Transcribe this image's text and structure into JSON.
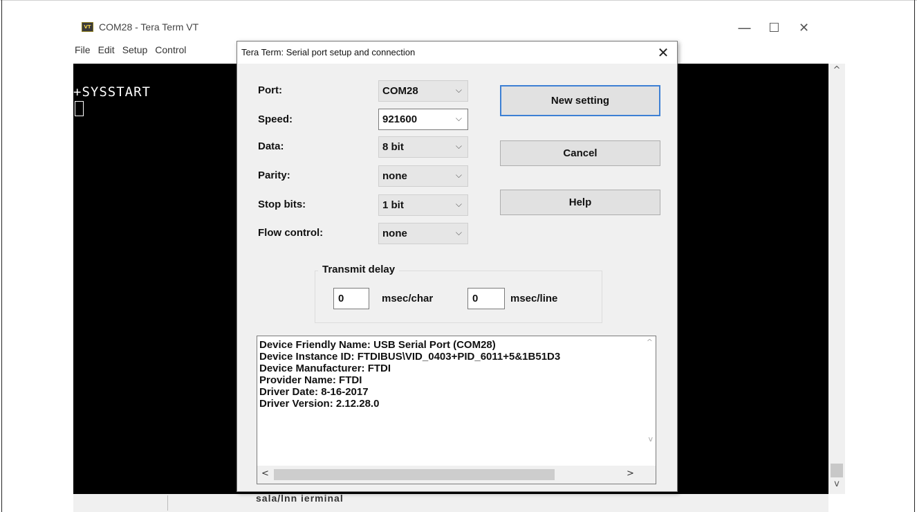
{
  "window": {
    "app_icon_text": "VT",
    "title": "COM28 - Tera Term VT",
    "minimize": "—",
    "maximize": "☐",
    "close": "✕"
  },
  "menu": [
    "File",
    "Edit",
    "Setup",
    "Control"
  ],
  "terminal": {
    "output_line": "+SYSSTART",
    "scroll_up": "^",
    "scroll_down": "v"
  },
  "status_bar": {
    "text": "sala/lnn  ierminal"
  },
  "dialog": {
    "title": "Tera Term: Serial port setup and connection",
    "close": "✕",
    "fields": [
      {
        "label": "Port:",
        "value": "COM28"
      },
      {
        "label": "Speed:",
        "value": "921600"
      },
      {
        "label": "Data:",
        "value": "8 bit"
      },
      {
        "label": "Parity:",
        "value": "none"
      },
      {
        "label": "Stop bits:",
        "value": "1 bit"
      },
      {
        "label": "Flow control:",
        "value": "none"
      }
    ],
    "buttons": {
      "new_setting": "New setting",
      "cancel": "Cancel",
      "help": "Help"
    },
    "transmit_delay": {
      "legend": "Transmit delay",
      "char_value": "0",
      "char_unit": "msec/char",
      "line_value": "0",
      "line_unit": "msec/line"
    },
    "device_info": [
      "Device Friendly Name: USB Serial Port (COM28)",
      "Device Instance ID: FTDIBUS\\VID_0403+PID_6011+5&1B51D3",
      "Device Manufacturer: FTDI",
      "Provider Name: FTDI",
      "Driver Date: 8-16-2017",
      "Driver Version: 2.12.28.0"
    ],
    "scroll": {
      "up": "^",
      "down": "v",
      "left": "<",
      "right": ">"
    }
  }
}
